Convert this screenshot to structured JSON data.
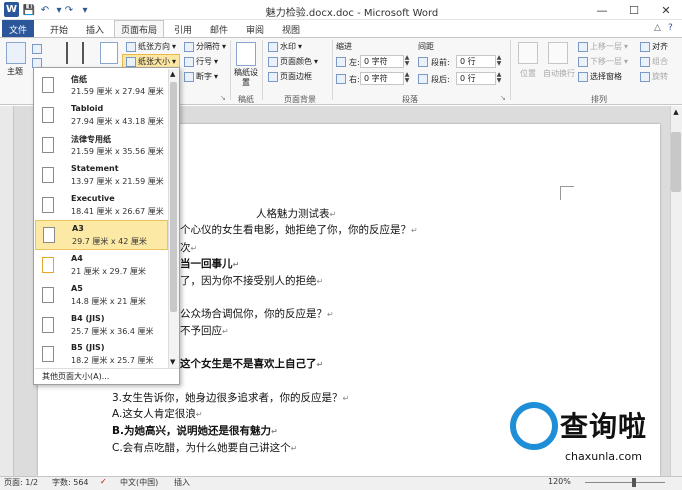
{
  "window": {
    "title": "魅力检验.docx.doc - Microsoft Word",
    "controls": [
      "minimize-icon",
      "maximize-icon",
      "close-icon"
    ]
  },
  "ribbon_tabs": [
    {
      "label": "文件"
    },
    {
      "label": "开始"
    },
    {
      "label": "插入"
    },
    {
      "label": "页面布局"
    },
    {
      "label": "引用"
    },
    {
      "label": "邮件"
    },
    {
      "label": "审阅"
    },
    {
      "label": "视图"
    }
  ],
  "ribbon": {
    "theme_label": "主题",
    "page_setup": {
      "orientation": "纸张方向",
      "size": "纸张大小",
      "columns": "分栏",
      "breaks": "分隔符",
      "line_numbers": "行号",
      "hyphenation": "断字"
    },
    "manuscript": {
      "label": "稿纸设置",
      "group": "稿纸"
    },
    "page_background": {
      "watermark": "水印",
      "page_color": "页面颜色",
      "page_border": "页面边框",
      "group": "页面背景"
    },
    "paragraph": {
      "indent_title": "缩进",
      "spacing_title": "间距",
      "left_label": "左:",
      "right_label": "右:",
      "before_label": "段前:",
      "after_label": "段后:",
      "left_value": "0 字符",
      "right_value": "0 字符",
      "before_value": "0 行",
      "after_value": "0 行",
      "group": "段落"
    },
    "arrange": {
      "position": "位置",
      "wrap": "自动换行",
      "bring_forward": "上移一层",
      "send_backward": "下移一层",
      "selection_pane": "选择窗格",
      "align": "对齐",
      "group_btn": "组合",
      "rotate": "旋转",
      "group": "排列"
    }
  },
  "paper_size_dropdown": {
    "items": [
      {
        "name": "信纸",
        "size": "21.59 厘米 x 27.94 厘米",
        "selected": false
      },
      {
        "name": "Tabloid",
        "size": "27.94 厘米 x 43.18 厘米",
        "selected": false
      },
      {
        "name": "法律专用纸",
        "size": "21.59 厘米 x 35.56 厘米",
        "selected": false
      },
      {
        "name": "Statement",
        "size": "13.97 厘米 x 21.59 厘米",
        "selected": false
      },
      {
        "name": "Executive",
        "size": "18.41 厘米 x 26.67 厘米",
        "selected": false
      },
      {
        "name": "A3",
        "size": "29.7 厘米 x 42 厘米",
        "selected": true
      },
      {
        "name": "A4",
        "size": "21 厘米 x 29.7 厘米",
        "selected": false
      },
      {
        "name": "A5",
        "size": "14.8 厘米 x 21 厘米",
        "selected": false
      },
      {
        "name": "B4 (JIS)",
        "size": "25.7 厘米 x 36.4 厘米",
        "selected": false
      },
      {
        "name": "B5 (JIS)",
        "size": "18.2 厘米 x 25.7 厘米",
        "selected": false
      }
    ],
    "more": "其他页面大小(A)..."
  },
  "document": {
    "lines": [
      {
        "text": "人格魅力测试表",
        "bold": false
      },
      {
        "text": "个心仪的女生看电影，她拒绝了你，你的反应是？",
        "bold": false
      },
      {
        "text": "次",
        "bold": false
      },
      {
        "text": "当一回事儿",
        "bold": true
      },
      {
        "text": "了，因为你不接受别人的拒绝",
        "bold": false
      },
      {
        "text": "公众场合调侃你，你的反应是？",
        "bold": false
      },
      {
        "text": "不予回应",
        "bold": false
      },
      {
        "text": "这个女生是不是喜欢上自己了",
        "bold": true
      },
      {
        "text": "3.女生告诉你，她身边很多追求者，你的反应是？",
        "bold": false
      },
      {
        "text": "A.这女人肯定很浪",
        "bold": false
      },
      {
        "text": "B.为她高兴，说明她还是很有魅力",
        "bold": true
      },
      {
        "text": "C.会有点吃醋，为什么她要自己讲这个",
        "bold": false
      }
    ]
  },
  "status_bar": {
    "page": "页面: 1/2",
    "words": "字数: 564",
    "language": "中文(中国)",
    "mode": "插入",
    "zoom": "120%"
  },
  "watermark": {
    "brand": "查询啦",
    "url": "chaxunla.com"
  }
}
